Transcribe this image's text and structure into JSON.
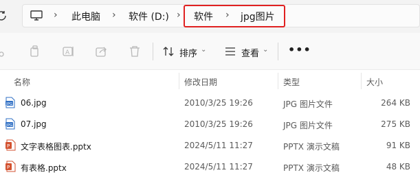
{
  "address_bar": {
    "crumbs": [
      "此电脑",
      "软件 (D:)",
      "软件",
      "jpg图片"
    ]
  },
  "toolbar": {
    "sort_label": "排序",
    "view_label": "查看",
    "more_label": "•••"
  },
  "columns": {
    "name": "名称",
    "modified": "修改日期",
    "type": "类型",
    "size": "大小"
  },
  "files": [
    {
      "name": "06.jpg",
      "modified": "2010/3/25 19:26",
      "type": "JPG 图片文件",
      "size": "264 KB",
      "icon": "jpg-file-icon"
    },
    {
      "name": "07.jpg",
      "modified": "2010/3/25 19:26",
      "type": "JPG 图片文件",
      "size": "275 KB",
      "icon": "jpg-file-icon"
    },
    {
      "name": "文字表格图表.pptx",
      "modified": "2024/5/11 11:27",
      "type": "PPTX 演示文稿",
      "size": "91 KB",
      "icon": "pptx-file-icon"
    },
    {
      "name": "有表格.pptx",
      "modified": "2024/5/11 11:27",
      "type": "PPTX 演示文稿",
      "size": "48 KB",
      "icon": "pptx-file-icon"
    }
  ],
  "colors": {
    "highlight": "#e02020",
    "jpg_icon": "#2f6fc4",
    "pptx_icon": "#d35230"
  }
}
